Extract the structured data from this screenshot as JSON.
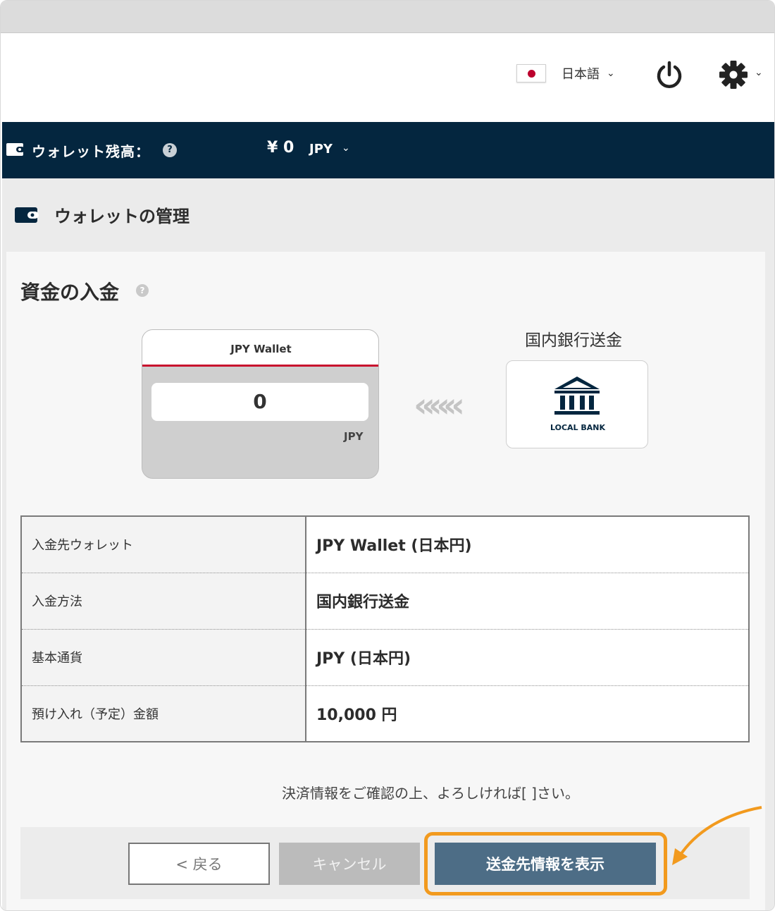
{
  "header": {
    "language_label": "日本語",
    "icons": [
      "japan-flag-icon",
      "power-icon",
      "gear-icon",
      "chevron-down-icon"
    ]
  },
  "wallet_bar": {
    "label": "ウォレット残高：",
    "help": "?",
    "amount": "¥ 0",
    "currency": "JPY"
  },
  "section": {
    "title": "ウォレットの管理"
  },
  "deposit": {
    "title": "資金の入金",
    "help": "?",
    "wallet_card": {
      "name": "JPY Wallet",
      "value": "0",
      "currency": "JPY"
    },
    "arrows": "«««",
    "method": {
      "label": "国内銀行送金",
      "logo_text": "LOCAL BANK"
    }
  },
  "table": {
    "rows": [
      {
        "key": "入金先ウォレット",
        "value": "JPY Wallet (日本円)"
      },
      {
        "key": "入金方法",
        "value": "国内銀行送金"
      },
      {
        "key": "基本通貨",
        "value": "JPY (日本円)"
      },
      {
        "key": "預け入れ（予定）金額",
        "value": "10,000 円"
      }
    ]
  },
  "note": "決済情報をご確認の上、よろしければ[ ]さい。",
  "buttons": {
    "back": "< 戻る",
    "cancel": "キャンセル",
    "show": "送金先情報を表示"
  },
  "colors": {
    "navy": "#04263f",
    "accent_red": "#c8102e",
    "primary_button": "#4d6d86",
    "highlight": "#f29a1e"
  }
}
